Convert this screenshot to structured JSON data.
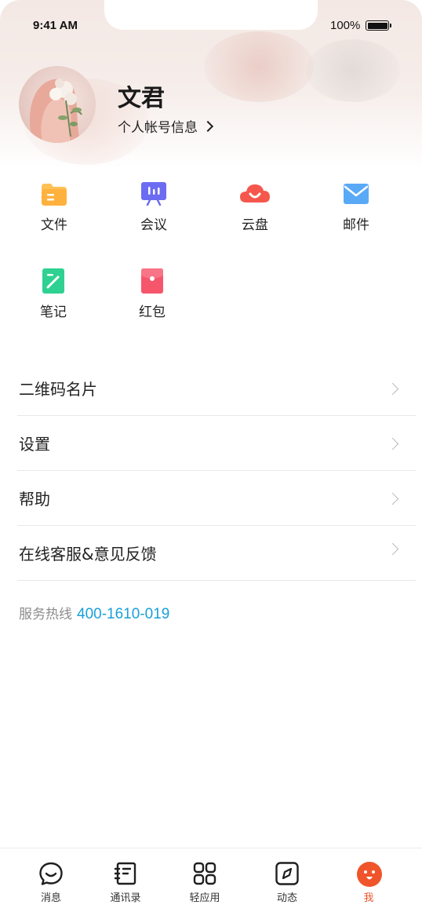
{
  "status_bar": {
    "time": "9:41 AM",
    "battery": "100%"
  },
  "profile": {
    "name": "文君",
    "account_link": "个人帐号信息"
  },
  "apps": [
    {
      "label": "文件",
      "icon": "folder-icon",
      "color": "#FFB84D"
    },
    {
      "label": "会议",
      "icon": "meeting-icon",
      "color": "#6C6CF2"
    },
    {
      "label": "云盘",
      "icon": "cloud-icon",
      "color": "#F5574C"
    },
    {
      "label": "邮件",
      "icon": "mail-icon",
      "color": "#5AA9F7"
    },
    {
      "label": "笔记",
      "icon": "note-icon",
      "color": "#2ED191"
    },
    {
      "label": "红包",
      "icon": "red-packet-icon",
      "color": "#F5566B"
    }
  ],
  "menu": [
    {
      "label": "二维码名片"
    },
    {
      "label": "设置"
    },
    {
      "label": "帮助"
    },
    {
      "label": "在线客服&意见反馈"
    }
  ],
  "hotline": {
    "label": "服务热线",
    "number": "400-1610-019"
  },
  "tabs": [
    {
      "label": "消息",
      "icon": "chat-icon",
      "active": false
    },
    {
      "label": "通讯录",
      "icon": "contacts-icon",
      "active": false
    },
    {
      "label": "轻应用",
      "icon": "apps-grid-icon",
      "active": false
    },
    {
      "label": "动态",
      "icon": "compass-icon",
      "active": false
    },
    {
      "label": "我",
      "icon": "me-icon",
      "active": true
    }
  ],
  "colors": {
    "accent": "#F0542A",
    "link": "#1A9FD9"
  }
}
